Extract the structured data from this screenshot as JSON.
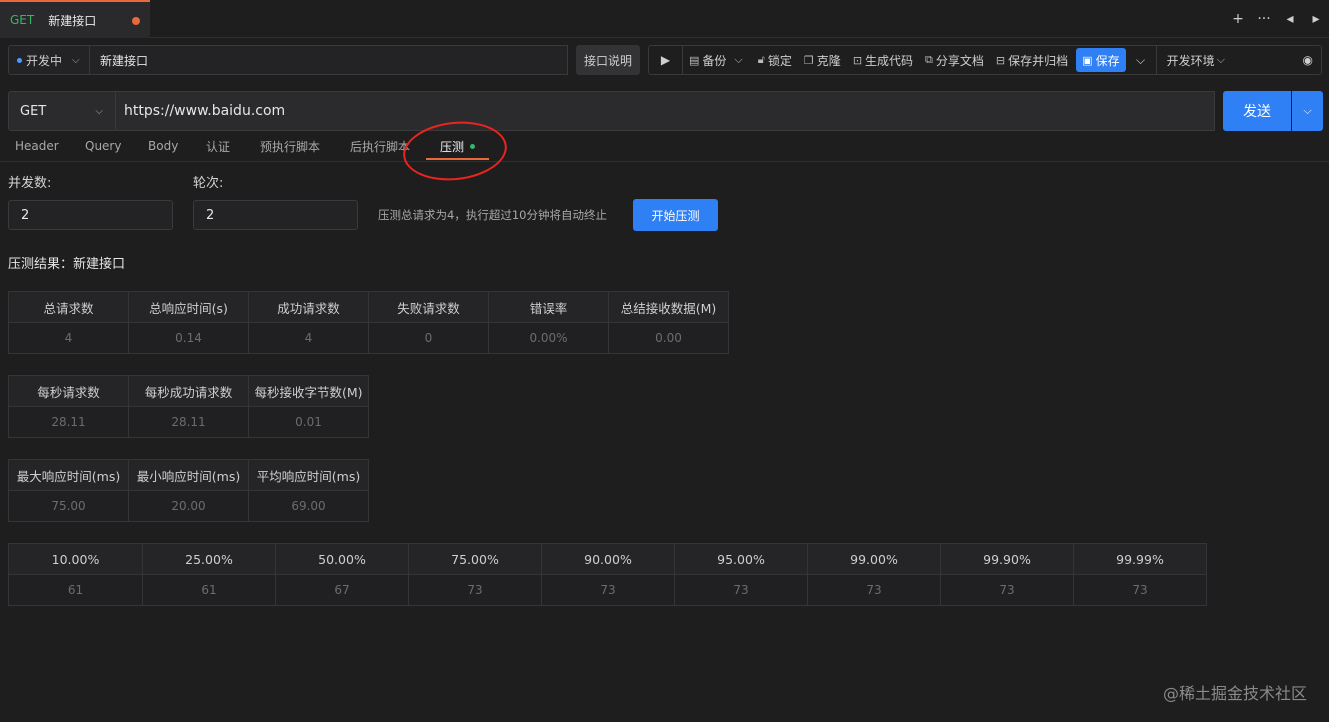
{
  "tab": {
    "method": "GET",
    "title": "新建接口"
  },
  "tabbar_icons": [
    "+",
    "···",
    "◂",
    "▸"
  ],
  "status": {
    "label": "开发中"
  },
  "api_name": "新建接口",
  "doc_button": "接口说明",
  "toolbar": {
    "backup": "备份",
    "lock": "锁定",
    "clone": "克隆",
    "gen_code": "生成代码",
    "share_doc": "分享文档",
    "save_archive": "保存并归档",
    "save": "保存",
    "env": "开发环境"
  },
  "request": {
    "method": "GET",
    "url": "https://www.baidu.com",
    "send": "发送"
  },
  "subtabs": [
    "Header",
    "Query",
    "Body",
    "认证",
    "预执行脚本",
    "后执行脚本",
    "压测"
  ],
  "form": {
    "concurrency_label": "并发数:",
    "concurrency_value": "2",
    "rounds_label": "轮次:",
    "rounds_value": "2",
    "hint": "压测总请求为4，执行超过10分钟将自动终止",
    "start_button": "开始压测"
  },
  "result_title": "压测结果：新建接口",
  "table1": {
    "headers": [
      "总请求数",
      "总响应时间(s)",
      "成功请求数",
      "失败请求数",
      "错误率",
      "总结接收数据(M)"
    ],
    "values": [
      "4",
      "0.14",
      "4",
      "0",
      "0.00%",
      "0.00"
    ]
  },
  "table2": {
    "headers": [
      "每秒请求数",
      "每秒成功请求数",
      "每秒接收字节数(M)"
    ],
    "values": [
      "28.11",
      "28.11",
      "0.01"
    ]
  },
  "table3": {
    "headers": [
      "最大响应时间(ms)",
      "最小响应时间(ms)",
      "平均响应时间(ms)"
    ],
    "values": [
      "75.00",
      "20.00",
      "69.00"
    ]
  },
  "table4": {
    "headers": [
      "10.00%",
      "25.00%",
      "50.00%",
      "75.00%",
      "90.00%",
      "95.00%",
      "99.00%",
      "99.90%",
      "99.99%"
    ],
    "values": [
      "61",
      "61",
      "67",
      "73",
      "73",
      "73",
      "73",
      "73",
      "73"
    ]
  },
  "watermark": "@稀土掘金技术社区"
}
